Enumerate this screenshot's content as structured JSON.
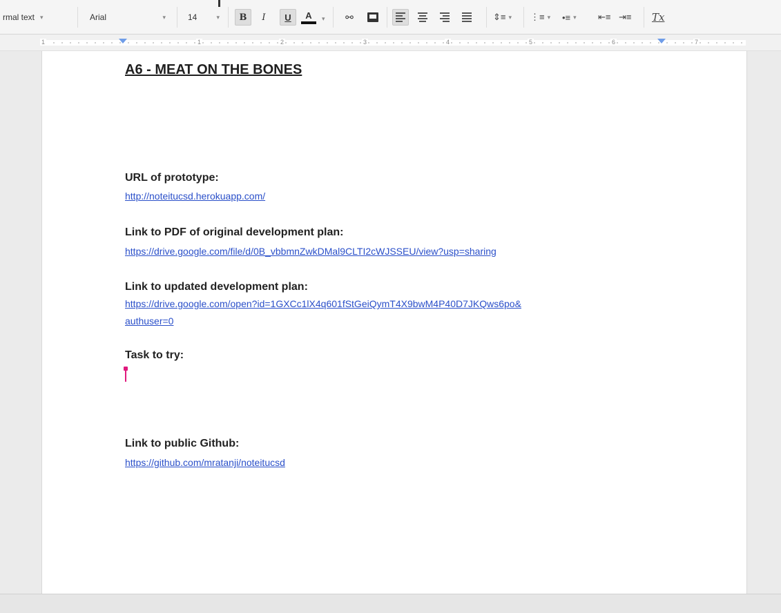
{
  "toolbar": {
    "style_label": "rmal text",
    "font_label": "Arial",
    "size_label": "14",
    "bold_label": "B",
    "italic_label": "I",
    "underline_label": "U",
    "text_color_label": "A",
    "link_glyph": "⚯",
    "clear_format_label": "Tx",
    "icons": [
      "link-icon",
      "comment-icon",
      "align-left-icon",
      "align-center-icon",
      "align-right-icon",
      "align-justify-icon",
      "line-spacing-icon",
      "numbered-list-icon",
      "bulleted-list-icon",
      "decrease-indent-icon",
      "increase-indent-icon",
      "clear-formatting-icon"
    ]
  },
  "ruler": {
    "numbers": [
      "1",
      "1",
      "2",
      "3",
      "4",
      "5",
      "6",
      "7"
    ]
  },
  "document": {
    "title": "A6 - MEAT ON THE BONES",
    "sections": [
      {
        "label": "URL of prototype:",
        "link": "http://noteitucsd.herokuapp.com/"
      },
      {
        "label": "Link to PDF of original development plan:",
        "link": "https://drive.google.com/file/d/0B_vbbmnZwkDMal9CLTI2cWJSSEU/view?usp=sharing"
      },
      {
        "label": "Link to updated development plan:",
        "link_line1": "https://drive.google.com/open?id=1GXCc1lX4q601fStGeiQymT4X9bwM4P40D7JKQws6po&",
        "link_line2": "authuser=0"
      },
      {
        "label": "Task to try:"
      },
      {
        "label": "Link to public Github:",
        "link": "https://github.com/mratanji/noteitucsd"
      }
    ]
  },
  "colors": {
    "link": "#2a4fc9",
    "cursor": "#e0197d",
    "indent_marker": "#6f9de8"
  }
}
